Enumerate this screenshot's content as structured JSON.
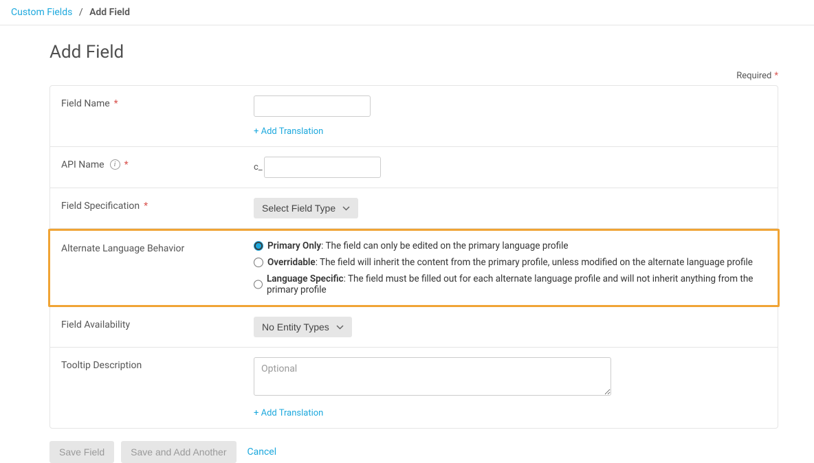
{
  "breadcrumb": {
    "parent": "Custom Fields",
    "separator": "/",
    "current": "Add Field"
  },
  "page_title": "Add Field",
  "required_label": "Required",
  "rows": {
    "field_name": {
      "label": "Field Name",
      "add_translation": "+ Add Translation"
    },
    "api_name": {
      "label": "API Name",
      "prefix": "c_"
    },
    "field_spec": {
      "label": "Field Specification",
      "select_label": "Select Field Type"
    },
    "alt_lang": {
      "label": "Alternate Language Behavior",
      "options": [
        {
          "name": "Primary Only",
          "desc": ": The field can only be edited on the primary language profile",
          "checked": true
        },
        {
          "name": "Overridable",
          "desc": ": The field will inherit the content from the primary profile, unless modified on the alternate language profile",
          "checked": false
        },
        {
          "name": "Language Specific",
          "desc": ": The field must be filled out for each alternate language profile and will not inherit anything from the primary profile",
          "checked": false
        }
      ]
    },
    "field_avail": {
      "label": "Field Availability",
      "select_label": "No Entity Types"
    },
    "tooltip": {
      "label": "Tooltip Description",
      "placeholder": "Optional",
      "add_translation": "+ Add Translation"
    }
  },
  "actions": {
    "save": "Save Field",
    "save_another": "Save and Add Another",
    "cancel": "Cancel"
  }
}
